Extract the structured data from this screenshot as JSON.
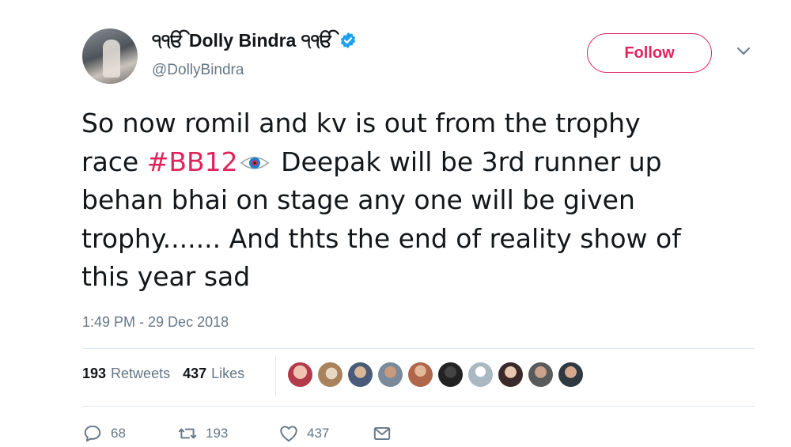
{
  "user": {
    "display_name": "੧ੴ Dolly Bindra ੧ੴ",
    "handle": "@DollyBindra",
    "verified_icon": "verified-badge-icon"
  },
  "header": {
    "follow_label": "Follow",
    "menu_icon": "chevron-down-icon"
  },
  "tweet": {
    "text_before_hashtag": "So now romil and kv is out from the trophy\nrace ",
    "hashtag": "#BB12",
    "emoji_icon": "eye-emoji-icon",
    "text_after_hashtag": " Deepak will be 3rd runner up\nbehan bhai on stage any one will be given\ntrophy....... And thts the end of reality show of\nthis year sad",
    "timestamp": "1:49 PM - 29 Dec 2018"
  },
  "stats": {
    "retweets_count": "193",
    "retweets_label": "Retweets",
    "likes_count": "437",
    "likes_label": "Likes",
    "liker_avatars": 10
  },
  "actions": {
    "reply_count": "68",
    "retweet_count": "193",
    "like_count": "437",
    "dm_icon": "envelope-icon"
  },
  "colors": {
    "accent": "#e0245e",
    "verified": "#1da1f2",
    "secondary_text": "#657786",
    "divider": "#e1e8ed"
  }
}
